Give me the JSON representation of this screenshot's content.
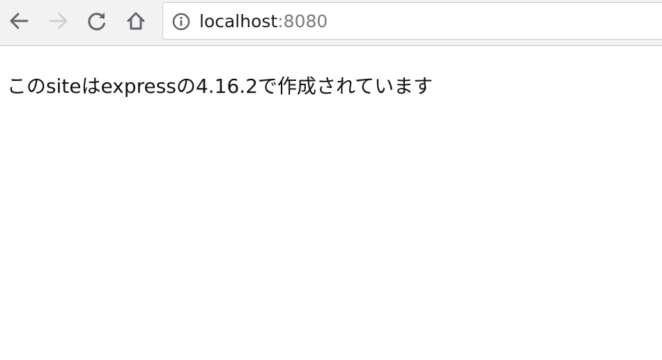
{
  "browser": {
    "nav": {
      "back_icon": "arrow-left-icon",
      "forward_icon": "arrow-right-icon",
      "reload_icon": "reload-icon",
      "home_icon": "home-icon"
    },
    "address_bar": {
      "site_info_icon": "info-icon",
      "host": "localhost",
      "port": ":8080"
    }
  },
  "page": {
    "message": "このsiteはexpressの4.16.2で作成されています"
  },
  "colors": {
    "toolbar_bg": "#f2f2f2",
    "icon_active": "#5f6368",
    "icon_disabled": "#cfcfcf",
    "port_text": "#7a7a7a"
  }
}
